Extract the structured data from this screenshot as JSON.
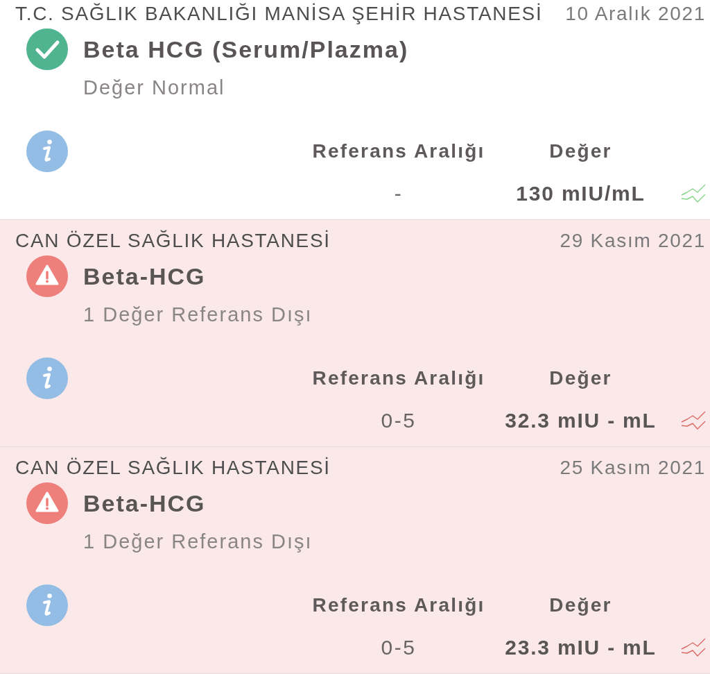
{
  "results": [
    {
      "hospital": "T.C. SAĞLIK BAKANLIĞI MANİSA ŞEHİR HASTANESİ",
      "date": "10 Aralık 2021",
      "out_of_range": false,
      "test_name": "Beta HCG (Serum/Plazma)",
      "summary": "Değer Normal",
      "columns": [
        "Referans Aralığı",
        "Değer"
      ],
      "reference_range": "-",
      "value": "130 mIU/mL"
    },
    {
      "hospital": "CAN ÖZEL SAĞLIK HASTANESİ",
      "date": "29 Kasım 2021",
      "out_of_range": true,
      "test_name": "Beta-HCG",
      "summary": "1 Değer Referans Dışı",
      "columns": [
        "Referans Aralığı",
        "Değer"
      ],
      "reference_range": "0-5",
      "value": "32.3 mIU - mL"
    },
    {
      "hospital": "CAN ÖZEL SAĞLIK HASTANESİ",
      "date": "25 Kasım 2021",
      "out_of_range": true,
      "test_name": "Beta-HCG",
      "summary": "1 Değer Referans Dışı",
      "columns": [
        "Referans Aralığı",
        "Değer"
      ],
      "reference_range": "0-5",
      "value": "23.3 mIU - mL"
    }
  ]
}
